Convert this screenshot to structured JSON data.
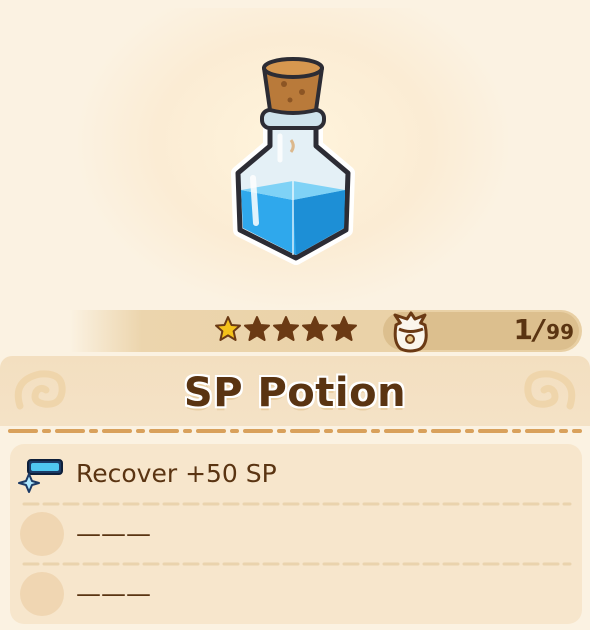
{
  "item": {
    "name": "SP Potion",
    "rarity_stars": 5,
    "rarity_filled": 1,
    "quantity": "1",
    "quantity_separator": "/",
    "quantity_max": "99",
    "icon": "blue-potion-bottle",
    "bag_icon": "item-bag-icon"
  },
  "effects": [
    {
      "text": "Recover +50 SP",
      "icon": "sp-gauge-icon"
    },
    {
      "text": "———",
      "icon": "empty-slot"
    },
    {
      "text": "———",
      "icon": "empty-slot"
    }
  ],
  "colors": {
    "background": "#fbf2e2",
    "text": "#5a3412",
    "star_filled": "#f4c21a",
    "star_empty": "#6b3a14",
    "liquid": "#2fa8ec",
    "counter_pill": "#dcbf8e"
  }
}
